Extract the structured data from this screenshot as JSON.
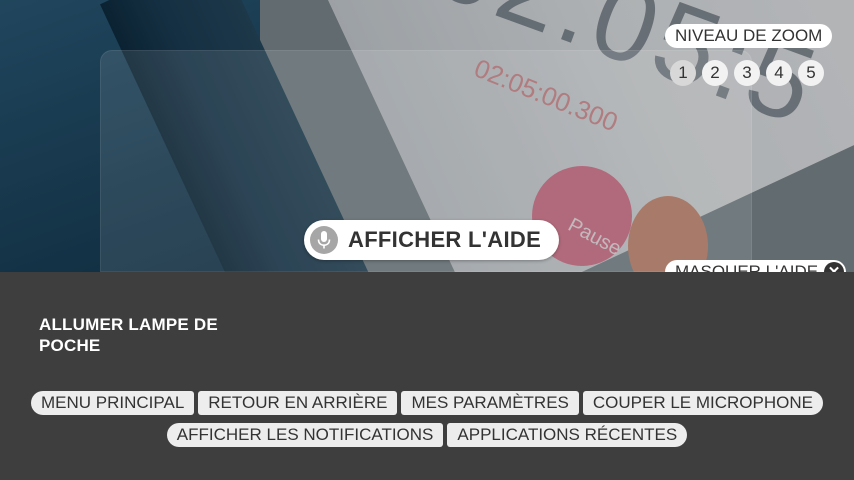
{
  "zoom": {
    "title": "NIVEAU DE ZOOM",
    "levels": [
      "1",
      "2",
      "3",
      "4",
      "5"
    ]
  },
  "help": {
    "show_label": "AFFICHER L'AIDE",
    "hide_label": "MASQUER L'AIDE"
  },
  "panel": {
    "flashlight_label": "ALLUMER LAMPE DE POCHE",
    "commands_row1": [
      "MENU PRINCIPAL",
      "RETOUR EN ARRIÈRE",
      "MES PARAMÈTRES",
      "COUPER LE MICROPHONE"
    ],
    "commands_row2": [
      "AFFICHER LES NOTIFICATIONS",
      "APPLICATIONS RÉCENTES"
    ]
  },
  "camera": {
    "background_digits": "02:05:5",
    "background_small": "02:05:00.300",
    "background_button": "Pause"
  },
  "colors": {
    "panel_bg": "#3e3e3e",
    "pill_bg": "#ffffff",
    "text_dark": "#333333"
  },
  "icons": {
    "microphone": "mic-icon",
    "close": "close-icon"
  }
}
